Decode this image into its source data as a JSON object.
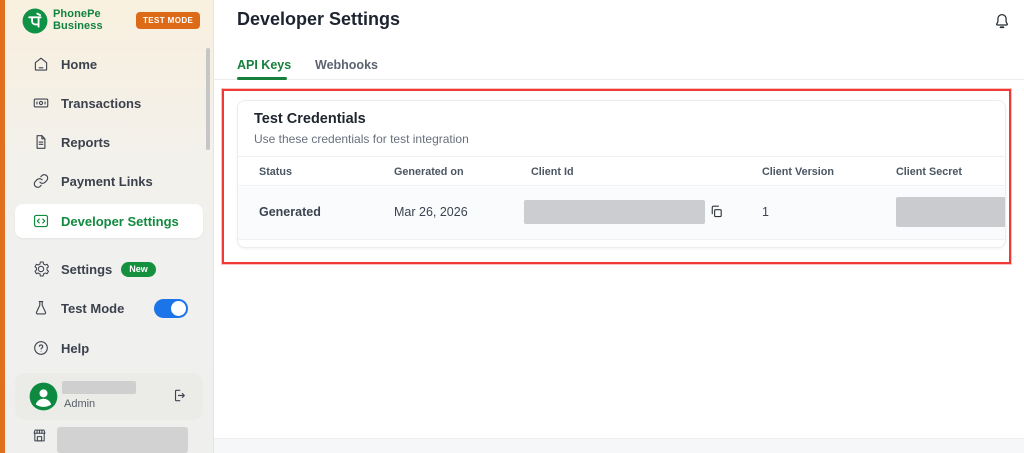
{
  "brand": {
    "name_line1": "PhonePe",
    "name_line2": "Business",
    "test_mode_badge": "TEST MODE"
  },
  "sidebar": {
    "items": [
      {
        "label": "Home",
        "icon": "home"
      },
      {
        "label": "Transactions",
        "icon": "banknote"
      },
      {
        "label": "Reports",
        "icon": "report-document"
      },
      {
        "label": "Payment Links",
        "icon": "link"
      },
      {
        "label": "Developer Settings",
        "icon": "code",
        "active": true
      },
      {
        "label": "Settings",
        "icon": "gear",
        "badge": "New"
      },
      {
        "label": "Test Mode",
        "icon": "flask",
        "toggle_on": true
      },
      {
        "label": "Help",
        "icon": "question"
      }
    ],
    "profile": {
      "role": "Admin",
      "name_redacted": true,
      "merchant_redacted": true
    }
  },
  "header": {
    "title": "Developer Settings"
  },
  "tabs": [
    {
      "label": "API Keys",
      "active": true
    },
    {
      "label": "Webhooks",
      "active": false
    }
  ],
  "test_credentials": {
    "title": "Test Credentials",
    "subtitle": "Use these credentials for test integration",
    "columns": [
      "Status",
      "Generated on",
      "Client Id",
      "Client Version",
      "Client Secret"
    ],
    "rows": [
      {
        "status": "Generated",
        "generated_on": "Mar 26, 2026",
        "client_id_redacted": true,
        "client_version": "1",
        "client_secret_redacted": true
      }
    ]
  },
  "colors": {
    "brand_green": "#12823f",
    "accent_orange": "#e0701d",
    "test_badge_orange": "#dd6a16",
    "new_badge_green": "#15903f",
    "toggle_blue": "#1b74e8",
    "annotation_red": "#ee3a35"
  }
}
